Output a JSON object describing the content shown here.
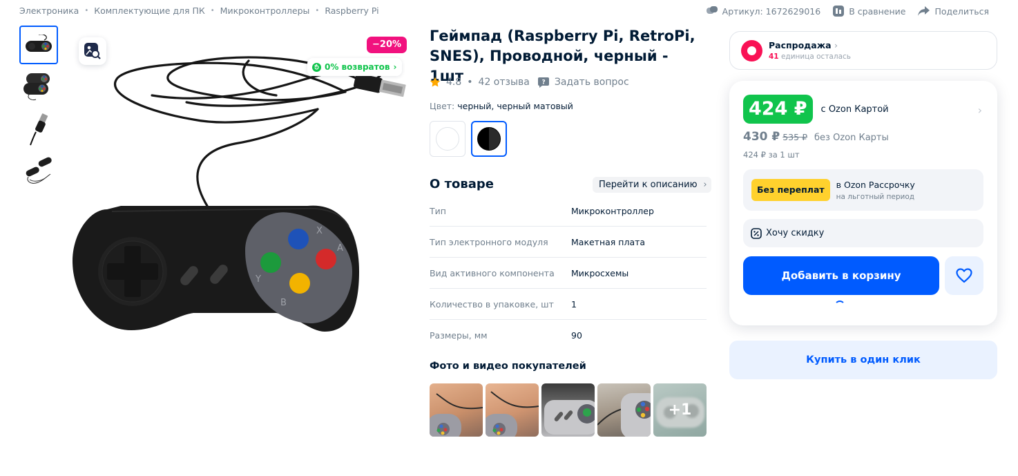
{
  "breadcrumbs": [
    "Электроника",
    "Комплектующие для ПК",
    "Микроконтроллеры",
    "Raspberry Pi"
  ],
  "top_actions": {
    "article": "Артикул: 1672629016",
    "compare": "В сравнение",
    "share": "Поделиться"
  },
  "gallery": {
    "discount_badge": "−20%",
    "returns_badge": "0% возвратов",
    "thumbnails": [
      "gamepad-front",
      "gamepad-pair",
      "usb-plug",
      "gamepad-cable"
    ]
  },
  "product": {
    "title": "Геймпад (Raspberry Pi, RetroPi, SNES), Проводной, черный - 1шт",
    "rating": "4.8",
    "reviews": "42 отзыва",
    "ask_question": "Задать вопрос",
    "color_label": "Цвет:",
    "color_value": "черный, черный матовый",
    "swatches": [
      "white",
      "black-matte"
    ]
  },
  "about": {
    "title": "О товаре",
    "goto_description": "Перейти к описанию",
    "specs": [
      {
        "key": "Тип",
        "value": "Микроконтроллер"
      },
      {
        "key": "Тип электронного модуля",
        "value": "Макетная плата"
      },
      {
        "key": "Вид активного компонента",
        "value": "Микросхемы"
      },
      {
        "key": "Количество в упаковке, шт",
        "value": "1"
      },
      {
        "key": "Размеры, мм",
        "value": "90"
      }
    ]
  },
  "ugc": {
    "title": "Фото и видео покупателей",
    "more": "+1"
  },
  "sale": {
    "title": "Распродажа",
    "count": "41",
    "remaining": "единица осталась"
  },
  "price": {
    "card_price": "424 ₽",
    "card_label": "с Ozon Картой",
    "regular_price": "430 ₽",
    "old_price": "535 ₽",
    "regular_label": "без Ozon Карты",
    "per_unit": "424 ₽ за 1 шт",
    "installment_badge": "Без переплат",
    "installment_title": "в Ozon Рассрочку",
    "installment_sub": "на льготный период",
    "want_discount": "Хочу скидку",
    "add_to_cart": "Добавить в корзину",
    "buy_one_click": "Купить в один клик"
  },
  "colors": {
    "accent": "#005bff",
    "green": "#10c44c",
    "pink": "#f1117e",
    "sale_red": "#f91155",
    "yellow": "#ffd12d"
  }
}
